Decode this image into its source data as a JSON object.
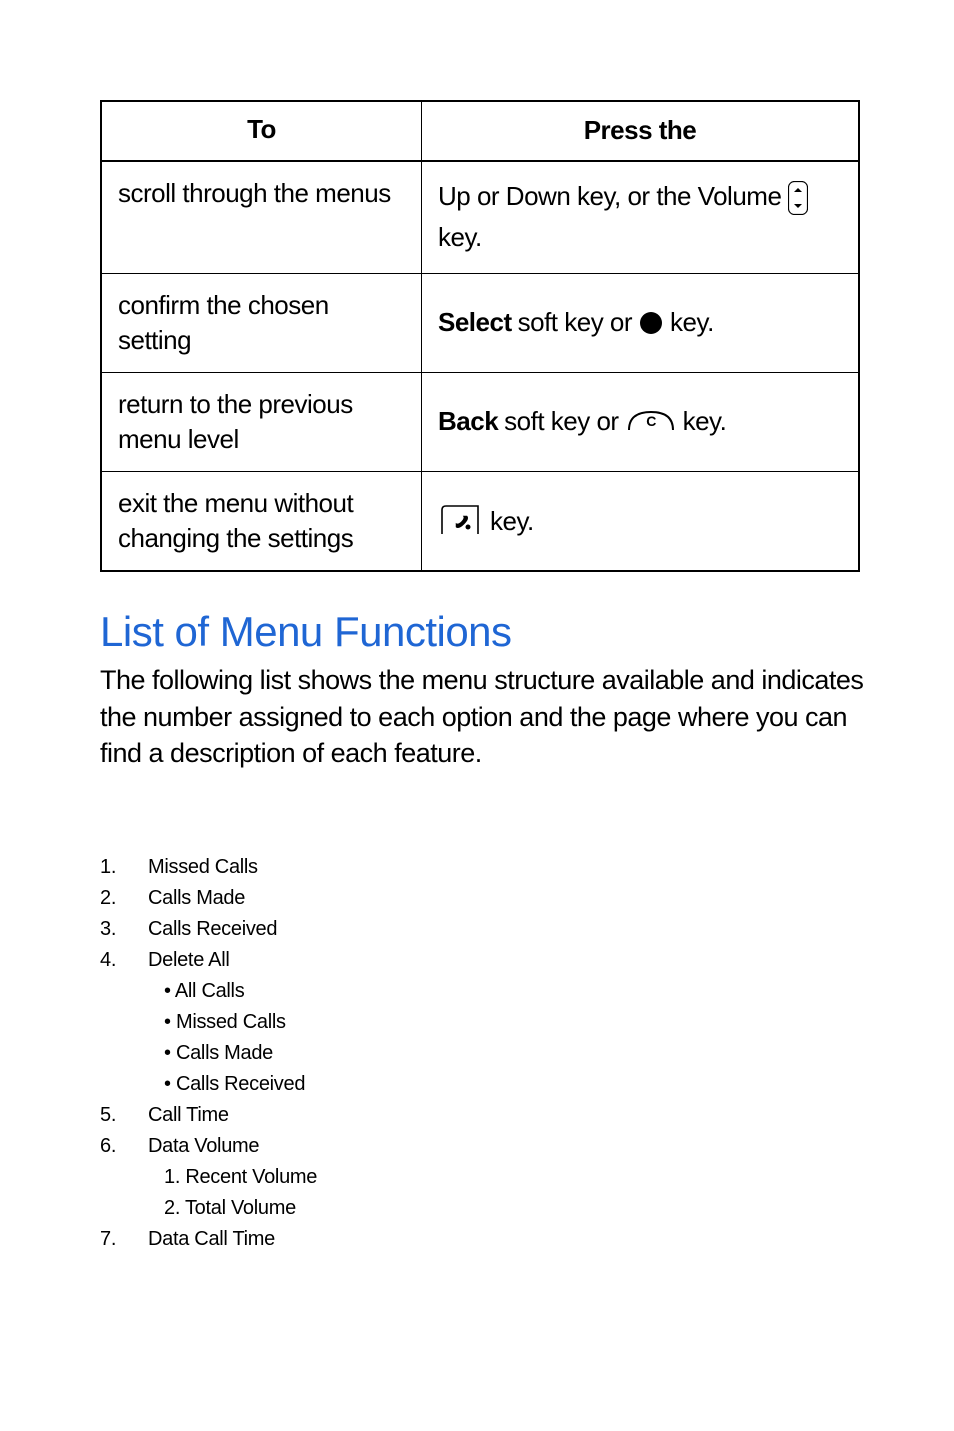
{
  "table": {
    "headers": {
      "left": "To",
      "right": "Press the"
    },
    "rows": [
      {
        "left": "scroll through the menus",
        "right_pre": "Up or Down key, or the Volume",
        "right_post": "key.",
        "icon": "volume"
      },
      {
        "left": "confirm the chosen setting",
        "right_bold": "Select",
        "right_mid": "soft key or",
        "right_post": "key.",
        "icon": "circle"
      },
      {
        "left": "return to the previous menu level",
        "right_bold": "Back",
        "right_mid": "soft key or",
        "right_post": "key.",
        "icon": "c-key"
      },
      {
        "left": "exit the menu without changing the settings",
        "right_post": "key.",
        "icon": "end-key"
      }
    ]
  },
  "heading": "List of Menu Functions",
  "paragraph": "The following list shows the menu structure available and indicates the number assigned to each option and the page where you can find a description of each feature.",
  "menu": [
    {
      "num": "1.",
      "label": "Missed Calls"
    },
    {
      "num": "2.",
      "label": "Calls Made"
    },
    {
      "num": "3.",
      "label": "Calls Received"
    },
    {
      "num": "4.",
      "label": "Delete All",
      "sub_bullets": [
        "• All Calls",
        "• Missed Calls",
        "• Calls Made",
        "• Calls Received"
      ]
    },
    {
      "num": "5.",
      "label": "Call Time"
    },
    {
      "num": "6.",
      "label": "Data Volume",
      "sub_numbered": [
        "1. Recent Volume",
        "2. Total Volume"
      ]
    },
    {
      "num": "7.",
      "label": "Data Call Time"
    }
  ]
}
